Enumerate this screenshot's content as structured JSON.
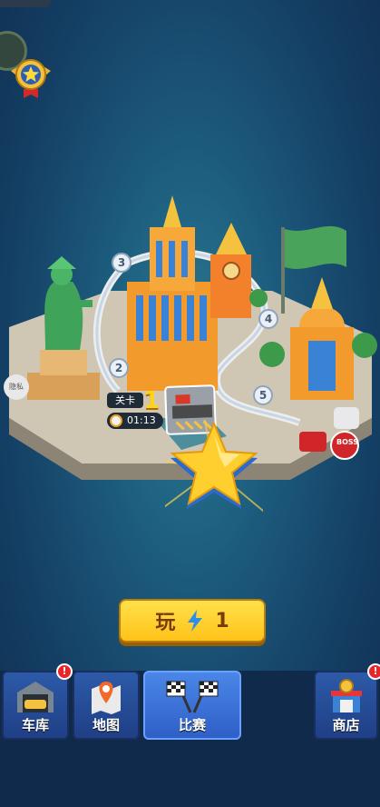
{
  "level": {
    "label": "关卡",
    "number": "1",
    "time": "01:13"
  },
  "map_nodes": [
    "2",
    "3",
    "4",
    "5"
  ],
  "boss_label": "BOSS",
  "privacy_label": "隐私",
  "play_button": {
    "label": "玩",
    "energy_cost": "1"
  },
  "bottom_nav": [
    {
      "label": "车库",
      "icon": "garage-car-icon",
      "badge": "!"
    },
    {
      "label": "地图",
      "icon": "map-pin-icon",
      "badge": ""
    },
    {
      "label": "比赛",
      "icon": "checkered-flags-icon",
      "badge": "",
      "active": true
    },
    {
      "label": "商店",
      "icon": "shop-icon",
      "badge": "!"
    }
  ],
  "colors": {
    "accent": "#ffc219",
    "nav_active": "#4a86e8",
    "nav": "#2d5aa8",
    "alert": "#e8262a"
  }
}
